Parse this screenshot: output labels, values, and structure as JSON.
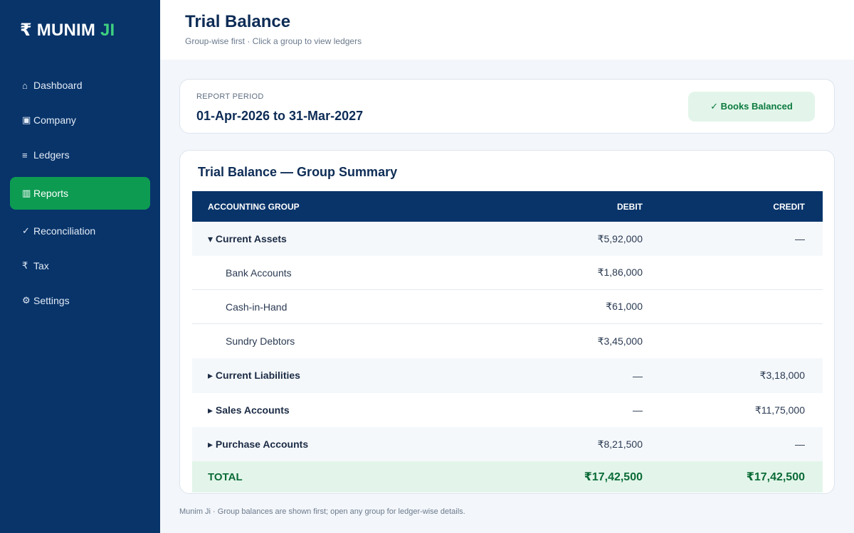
{
  "brand": {
    "symbol": "₹",
    "name": "MUNIM",
    "accent": "JI"
  },
  "nav": [
    {
      "icon": "⌂",
      "label": "Dashboard"
    },
    {
      "icon": "▣",
      "label": "Company"
    },
    {
      "icon": "≡",
      "label": "Ledgers"
    },
    {
      "icon": "▥",
      "label": "Reports",
      "active": true
    },
    {
      "icon": "✓",
      "label": "Reconciliation"
    },
    {
      "icon": "₹",
      "label": "Tax"
    },
    {
      "icon": "⚙",
      "label": "Settings"
    }
  ],
  "header": {
    "title": "Trial Balance",
    "subtitle": "Group-wise first · Click a group to view ledgers"
  },
  "period": {
    "label": "REPORT PERIOD",
    "value": "01-Apr-2026 to 31-Mar-2027",
    "badge": "✓ Books Balanced"
  },
  "table": {
    "title": "Trial Balance — Group Summary",
    "columns": [
      "ACCOUNTING GROUP",
      "DEBIT",
      "CREDIT"
    ],
    "groups": [
      {
        "name": "▾ Current Assets",
        "debit": "₹5,92,000",
        "credit": "—",
        "ledgers": [
          {
            "name": "Bank Accounts",
            "debit": "₹1,86,000",
            "credit": ""
          },
          {
            "name": "Cash-in-Hand",
            "debit": "₹61,000",
            "credit": ""
          },
          {
            "name": "Sundry Debtors",
            "debit": "₹3,45,000",
            "credit": ""
          }
        ]
      },
      {
        "name": "▸ Current Liabilities",
        "debit": "—",
        "credit": "₹3,18,000"
      },
      {
        "name": "▸ Sales Accounts",
        "debit": "—",
        "credit": "₹11,75,000"
      },
      {
        "name": "▸ Purchase Accounts",
        "debit": "₹8,21,500",
        "credit": "—"
      }
    ],
    "total": {
      "label": "TOTAL",
      "debit": "₹17,42,500",
      "credit": "₹17,42,500"
    }
  },
  "footnote": "Munim Ji · Group balances are shown first; open any group for ledger-wise details.",
  "colors": {
    "sidebar": "#08346a",
    "accent": "#0d9b52",
    "balanced_bg": "#e3f5ea",
    "balanced_text": "#0b7a3f"
  }
}
